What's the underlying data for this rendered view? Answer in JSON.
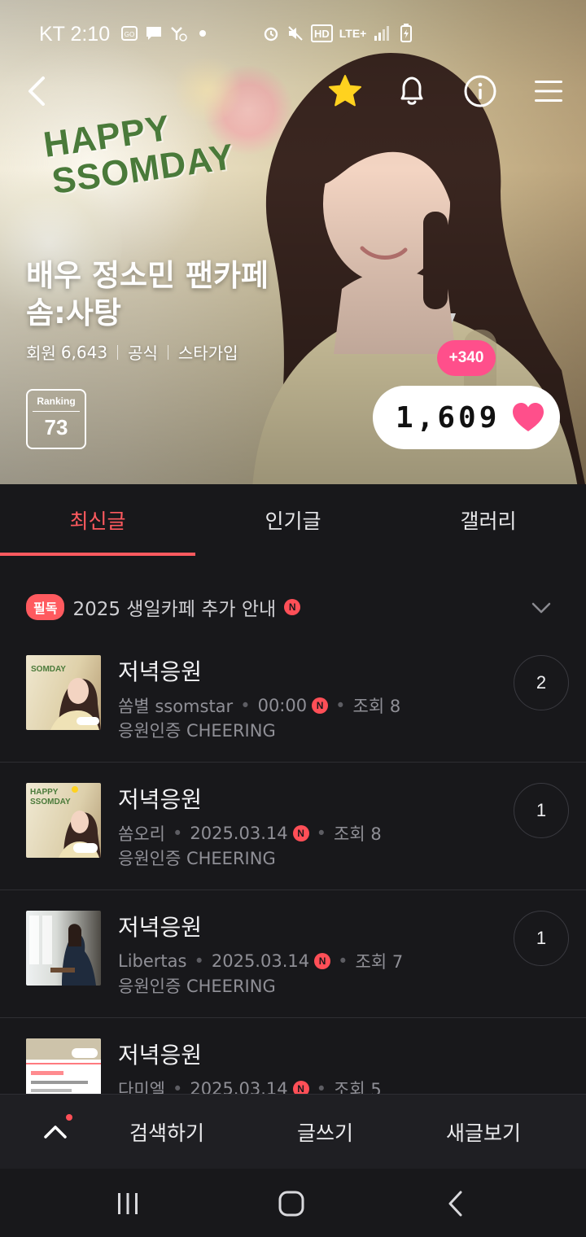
{
  "status_bar": {
    "carrier_time": "KT 2:10",
    "icons": [
      "gallery-notification-icon",
      "chat-icon",
      "missed-call-icon",
      "dot-icon",
      "alarm-icon",
      "mute-icon",
      "hd-voice-icon",
      "lte-plus-icon",
      "signal-icon",
      "battery-charging-icon"
    ],
    "hd_label": "HD",
    "lte_label": "LTE+"
  },
  "top_nav": {
    "icons": [
      "back-icon",
      "favorite-star-icon",
      "notification-bell-icon",
      "info-icon",
      "menu-icon"
    ],
    "star_color": "#ffd21f"
  },
  "hero": {
    "overlay_text_line1": "HAPPY",
    "overlay_text_line2": "SSOMDAY",
    "title_line1": "배우 정소민 팬카페",
    "title_line2": "솜:사탕",
    "meta": {
      "members_label": "회원",
      "members_count": "6,643",
      "tag1": "공식",
      "tag2": "스타가입"
    },
    "ranking_label": "Ranking",
    "ranking_value": "73",
    "likes_delta": "+340",
    "likes_count": "1,609",
    "heart_color": "#ff4f8b"
  },
  "tabs": [
    {
      "label": "최신글",
      "active": true
    },
    {
      "label": "인기글",
      "active": false
    },
    {
      "label": "갤러리",
      "active": false
    }
  ],
  "notice": {
    "badge": "필독",
    "text": "2025 생일카페 추가 안내",
    "new_badge": "N"
  },
  "posts": [
    {
      "title": "저녁응원",
      "author": "쏨별 ssomstar",
      "date": "00:00",
      "new_badge": "N",
      "views": "조회 8",
      "category": "응원인증 CHEERING",
      "comments": "2"
    },
    {
      "title": "저녁응원",
      "author": "쏨오리",
      "date": "2025.03.14",
      "new_badge": "N",
      "views": "조회 8",
      "category": "응원인증 CHEERING",
      "comments": "1"
    },
    {
      "title": "저녁응원",
      "author": "Libertas",
      "date": "2025.03.14",
      "new_badge": "N",
      "views": "조회 7",
      "category": "응원인증 CHEERING",
      "comments": "1"
    },
    {
      "title": "저녁응원",
      "author": "다미엘",
      "date": "2025.03.14",
      "new_badge": "N",
      "views": "조회 5",
      "category": "",
      "comments": ""
    }
  ],
  "bottom_bar": {
    "search_label": "검색하기",
    "write_label": "글쓰기",
    "new_posts_label": "새글보기"
  },
  "system_nav": {
    "icons": [
      "recent-apps-icon",
      "home-icon",
      "back-icon"
    ]
  },
  "colors": {
    "accent": "#ff5a5f",
    "background": "#18181b",
    "pink": "#ff4f8b"
  }
}
